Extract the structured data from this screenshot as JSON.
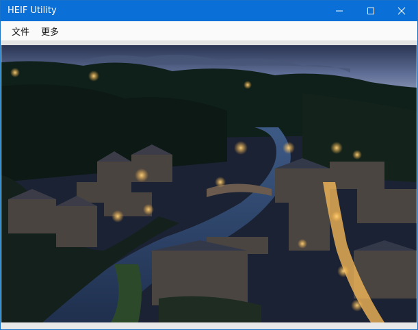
{
  "window": {
    "title": "HEIF Utility",
    "controls": {
      "minimize": "minimize-icon",
      "maximize": "maximize-icon",
      "close": "close-icon"
    }
  },
  "menu": {
    "items": [
      {
        "label": "文件"
      },
      {
        "label": "更多"
      }
    ]
  },
  "colors": {
    "titlebar": "#0a6fd6",
    "window_border": "#1a73c9",
    "menubar": "#fafafa"
  }
}
